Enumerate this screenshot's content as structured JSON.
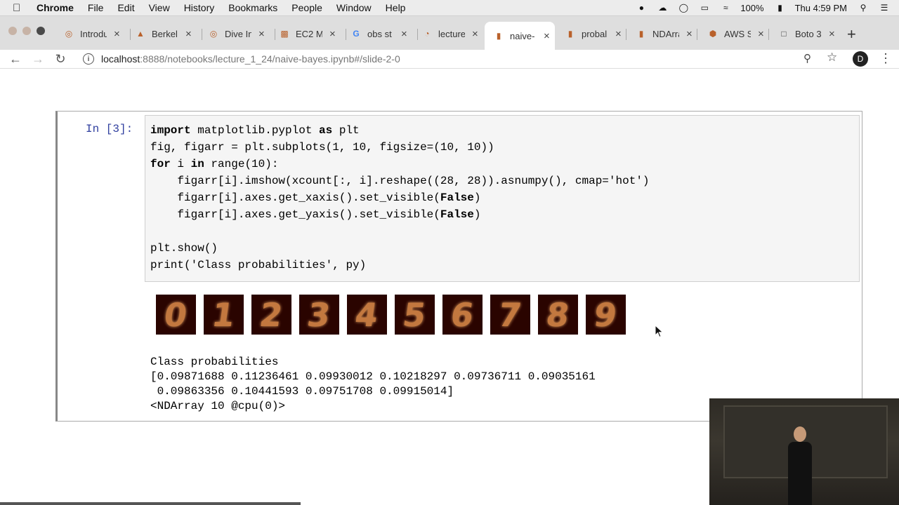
{
  "menubar": {
    "app": "Chrome",
    "items": [
      "File",
      "Edit",
      "View",
      "History",
      "Bookmarks",
      "People",
      "Window",
      "Help"
    ],
    "battery": "100%",
    "clock": "Thu 4:59 PM"
  },
  "tabs": [
    {
      "label": "Introdu",
      "icon": "globe-icon"
    },
    {
      "label": "Berkel",
      "icon": "berkeley-icon"
    },
    {
      "label": "Dive In",
      "icon": "globe-icon"
    },
    {
      "label": "EC2 M",
      "icon": "aws-icon"
    },
    {
      "label": "obs st",
      "icon": "google-icon"
    },
    {
      "label": "lecture",
      "icon": "jupyter-icon"
    },
    {
      "label": "naive-",
      "icon": "jupyter-icon"
    },
    {
      "label": "probal",
      "icon": "jupyter-icon"
    },
    {
      "label": "NDArra",
      "icon": "jupyter-icon"
    },
    {
      "label": "AWS S",
      "icon": "aws-icon"
    },
    {
      "label": "Boto 3",
      "icon": "document-icon"
    }
  ],
  "toolbar": {
    "url_host": "localhost",
    "url_path": ":8888/notebooks/lecture_1_24/naive-bayes.ipynb#/slide-2-0",
    "avatar_letter": "D"
  },
  "cell": {
    "prompt": "In [3]:",
    "digits": [
      "0",
      "1",
      "2",
      "3",
      "4",
      "5",
      "6",
      "7",
      "8",
      "9"
    ],
    "output_lines": [
      "Class probabilities",
      "[0.09871688 0.11236461 0.09930012 0.10218297 0.09736711 0.09035161",
      " 0.09863356 0.10441593 0.09751708 0.09915014]",
      "<NDArray 10 @cpu(0)>"
    ]
  },
  "code": {
    "l1_kw1": "import",
    "l1_a": " matplotlib.pyplot ",
    "l1_kw2": "as",
    "l1_b": " plt",
    "l2": "fig, figarr = plt.subplots(1, 10, figsize=(10, 10))",
    "l3_kw1": "for",
    "l3_a": " i ",
    "l3_kw2": "in",
    "l3_b": " range(10):",
    "l4": "    figarr[i].imshow(xcount[:, i].reshape((28, 28)).asnumpy(), cmap='hot')",
    "l5_a": "    figarr[i].axes.get_xaxis().set_visible(",
    "l5_kw": "False",
    "l5_b": ")",
    "l6_a": "    figarr[i].axes.get_yaxis().set_visible(",
    "l6_kw": "False",
    "l6_b": ")",
    "l7": "",
    "l8": "plt.show()",
    "l9": "print('Class probabilities', py)"
  }
}
